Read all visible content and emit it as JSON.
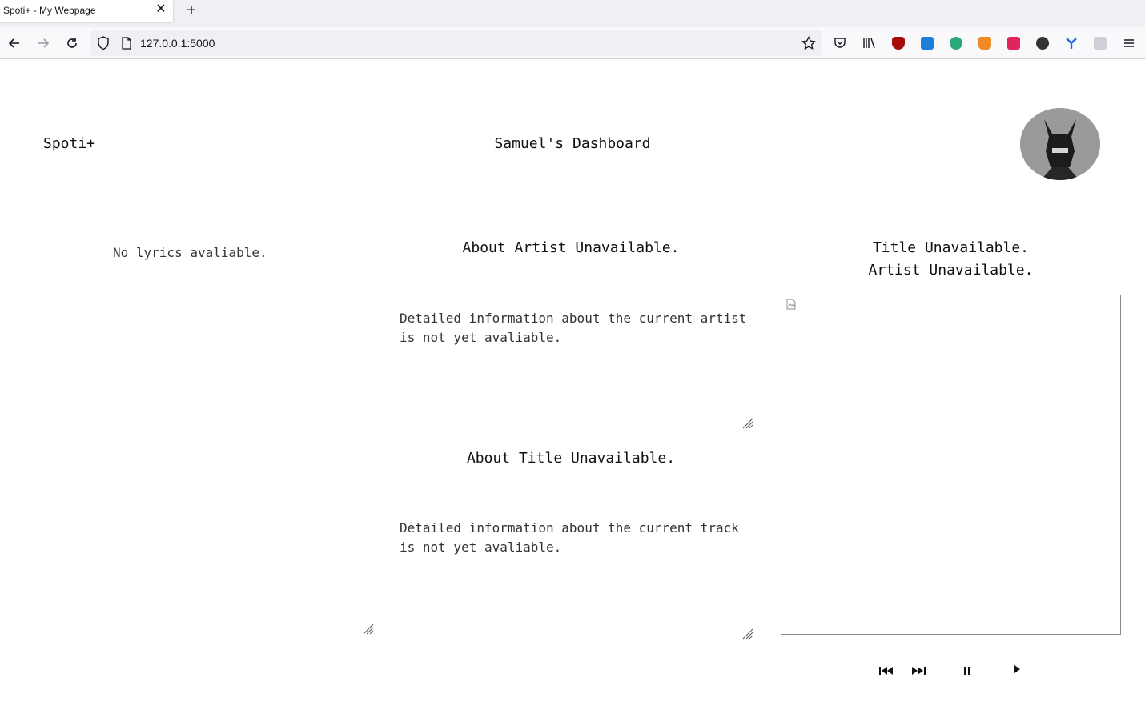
{
  "browser": {
    "tab_title": "Spoti+ - My Webpage",
    "tab_close": "✕",
    "new_tab": "+",
    "url": "127.0.0.1:5000"
  },
  "header": {
    "brand": "Spoti+",
    "title": "Samuel's Dashboard"
  },
  "lyrics": {
    "text": "No lyrics avaliable."
  },
  "artist": {
    "heading": "About Artist Unavailable.",
    "description": "Detailed information about the current artist is not yet avaliable."
  },
  "track": {
    "heading": "About Title Unavailable.",
    "description": "Detailed information about the current track is not yet avaliable."
  },
  "now_playing": {
    "title": "Title Unavailable.",
    "artist": "Artist Unavailable."
  },
  "controls": {
    "icons": [
      "previous-icon",
      "next-icon",
      "pause-icon",
      "play-icon"
    ]
  },
  "colors": {
    "extensions": [
      "#a50d0d",
      "#1e7fd8",
      "#2aa87a",
      "#f08a24",
      "#e0245e",
      "#333333",
      "#1b6fd1",
      "#cfcfd8"
    ]
  }
}
